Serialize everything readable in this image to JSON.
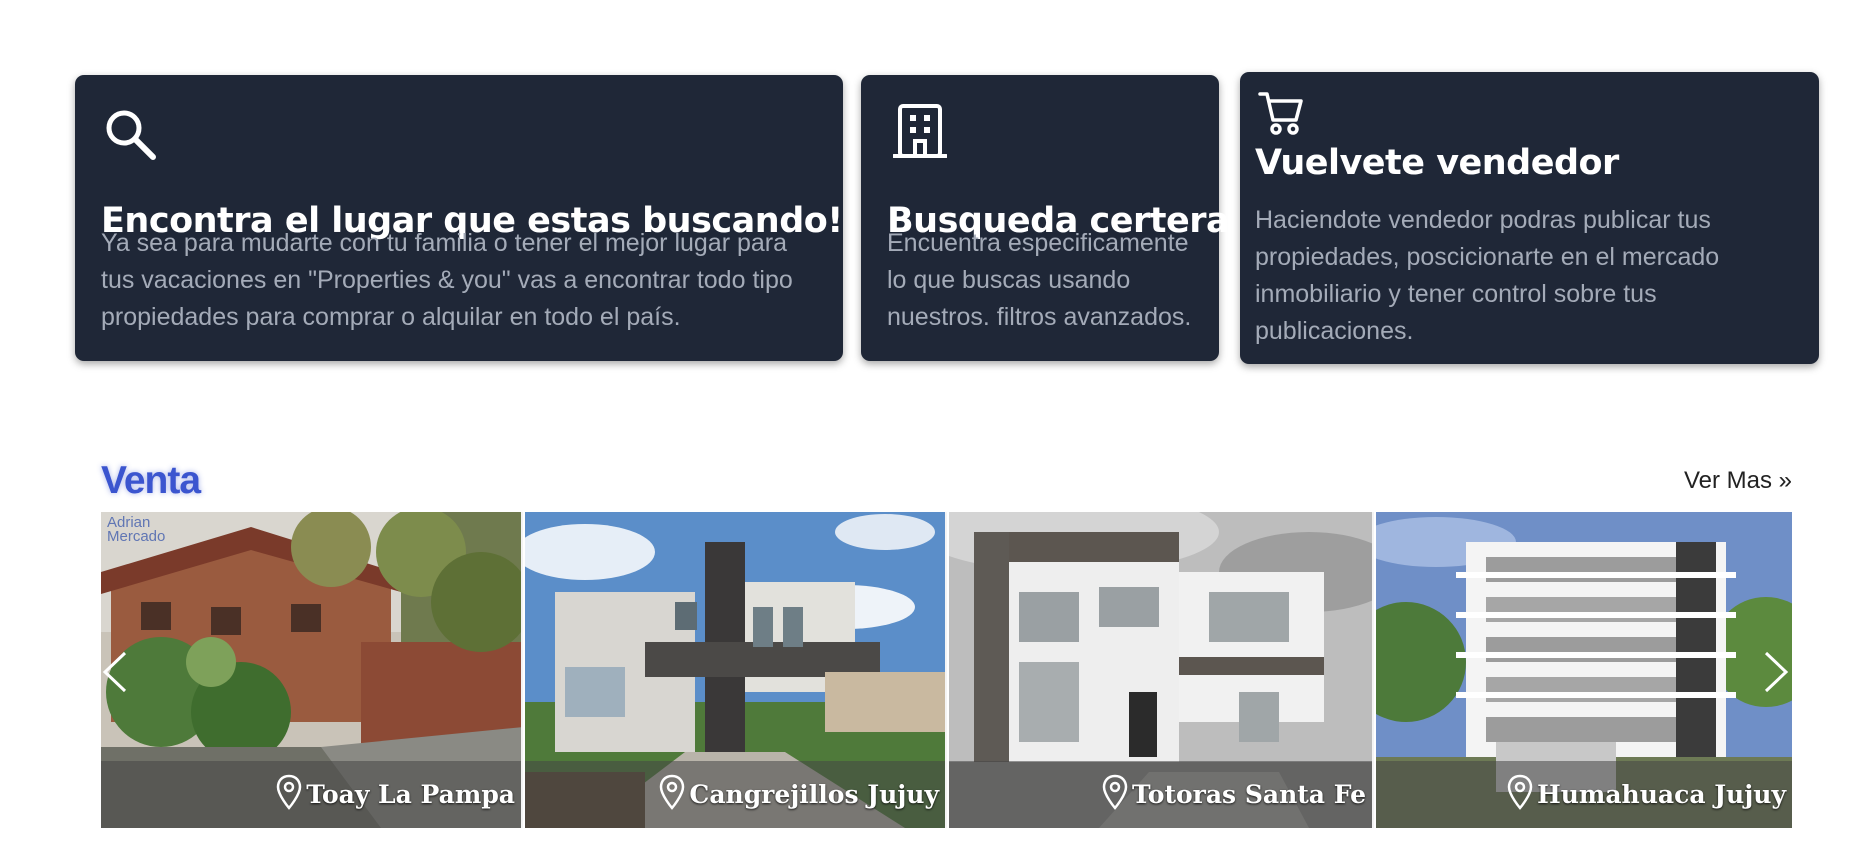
{
  "features": [
    {
      "icon": "search-icon",
      "title": "Encontra el lugar que estas buscando!",
      "description": "Ya sea para mudarte con tu familia o tener el mejor lugar para tus vacaciones en \"Properties & you\" vas a encontrar todo tipo propiedades para comprar o alquilar en todo el país."
    },
    {
      "icon": "building-icon",
      "title": "Busqueda certera",
      "description": "Encuentra especificamente lo que buscas usando nuestros. filtros avanzados."
    },
    {
      "icon": "cart-icon",
      "title": "Vuelvete vendedor",
      "description": "Haciendote vendedor podras publicar tus propiedades, poscicionarte en el mercado inmobiliario y tener control sobre tus publicaciones."
    }
  ],
  "sale_section": {
    "title": "Venta",
    "more_link": "Ver Mas »",
    "watermark": [
      "Adrian",
      "Mercado"
    ],
    "listings": [
      {
        "location": "Toay La Pampa",
        "icon": "map-pin-icon"
      },
      {
        "location": "Cangrejillos Jujuy",
        "icon": "map-pin-icon"
      },
      {
        "location": "Totoras Santa Fe",
        "icon": "map-pin-icon"
      },
      {
        "location": "Humahuaca Jujuy",
        "icon": "map-pin-icon"
      }
    ],
    "prev_icon": "chevron-left-icon",
    "next_icon": "chevron-right-icon"
  },
  "colors": {
    "card_bg": "#1f2737",
    "card_text_muted": "#a4abb8",
    "section_title": "#3b55cf"
  }
}
